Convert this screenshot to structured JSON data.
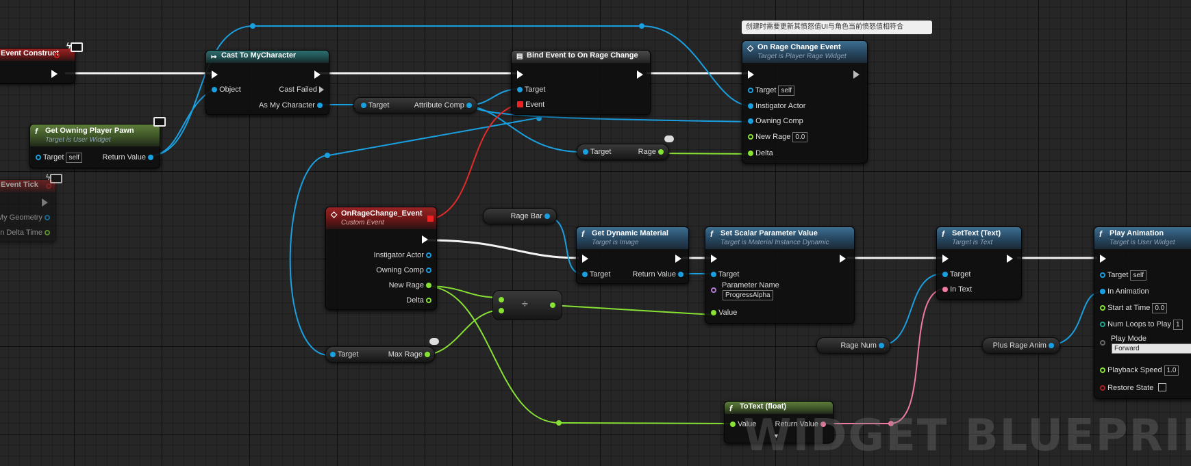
{
  "comment": {
    "text": "创建时需要更新其愤怒值UI与角色当前愤怒值相符合"
  },
  "watermark": "WIDGET BLUEPRINT",
  "nodes": {
    "event_construct": {
      "title": "Event Construct"
    },
    "event_tick": {
      "title": "Event Tick",
      "pins": {
        "geometry": "My Geometry",
        "delta": "n Delta Time"
      }
    },
    "get_owning_player_pawn": {
      "title": "Get Owning Player Pawn",
      "subtitle": "Target is User Widget",
      "target": "Target",
      "target_value": "self",
      "return": "Return Value"
    },
    "cast_to": {
      "title": "Cast To MyCharacter",
      "object": "Object",
      "cast_failed": "Cast Failed",
      "as_char": "As My Character"
    },
    "bind_event": {
      "title": "Bind Event to On Rage Change",
      "target": "Target",
      "event": "Event"
    },
    "on_rage_change_event": {
      "title": "On Rage Change Event",
      "subtitle": "Target is Player Rage Widget",
      "target": "Target",
      "target_value": "self",
      "instigator": "Instigator Actor",
      "owning": "Owning Comp",
      "new_rage": "New Rage",
      "new_rage_value": "0.0",
      "delta": "Delta"
    },
    "custom_event": {
      "title": "OnRageChange_Event",
      "subtitle": "Custom Event",
      "instigator": "Instigator Actor",
      "owning": "Owning Comp",
      "new_rage": "New Rage",
      "delta": "Delta"
    },
    "get_dynamic_material": {
      "title": "Get Dynamic Material",
      "subtitle": "Target is Image",
      "target": "Target",
      "return": "Return Value"
    },
    "set_scalar": {
      "title": "Set Scalar Parameter Value",
      "subtitle": "Target is Material Instance Dynamic",
      "target": "Target",
      "param_name": "Parameter Name",
      "param_value": "ProgressAlpha",
      "value": "Value"
    },
    "set_text": {
      "title": "SetText (Text)",
      "subtitle": "Target is Text",
      "target": "Target",
      "in_text": "In Text"
    },
    "play_animation": {
      "title": "Play Animation",
      "subtitle": "Target is User Widget",
      "target": "Target",
      "target_value": "self",
      "in_anim": "In Animation",
      "start": "Start at Time",
      "start_value": "0.0",
      "loops": "Num Loops to Play",
      "loops_value": "1",
      "mode": "Play Mode",
      "mode_value": "Forward",
      "speed": "Playback Speed",
      "speed_value": "1.0",
      "restore": "Restore State"
    },
    "to_text": {
      "title": "ToText (float)",
      "value": "Value",
      "return": "Return Value"
    },
    "divide": {
      "symbol": "÷"
    }
  },
  "variables": {
    "attribute_comp": {
      "target": "Target",
      "label": "Attribute Comp"
    },
    "rage": {
      "target": "Target",
      "label": "Rage"
    },
    "max_rage": {
      "target": "Target",
      "label": "Max Rage"
    },
    "rage_bar": {
      "label": "Rage Bar"
    },
    "rage_num": {
      "label": "Rage Num"
    },
    "plus_rage_anim": {
      "label": "Plus Rage Anim"
    }
  },
  "colors": {
    "exec": "#ffffff",
    "object": "#1aa0e0",
    "float": "#88e234",
    "text": "#f07aa0",
    "delegate": "#ee2222"
  }
}
